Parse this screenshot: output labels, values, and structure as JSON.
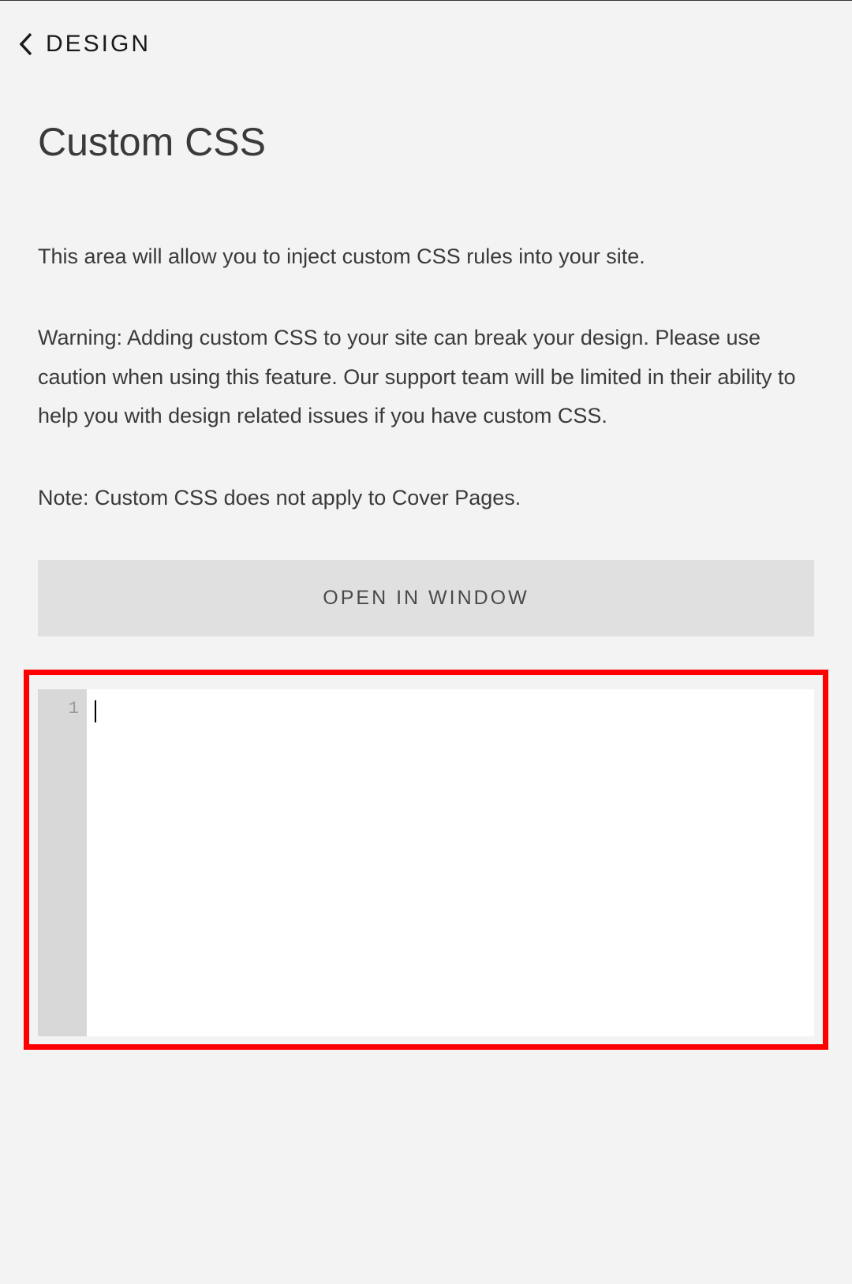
{
  "header": {
    "breadcrumb": "DESIGN"
  },
  "page": {
    "title": "Custom CSS",
    "description": "This area will allow you to inject custom CSS rules into your site.",
    "warning": "Warning: Adding custom CSS to your site can break your design. Please use caution when using this feature. Our support team will be limited in their ability to help you with design related issues if you have custom CSS.",
    "note": "Note: Custom CSS does not apply to Cover Pages."
  },
  "buttons": {
    "open_in_window": "OPEN IN WINDOW"
  },
  "editor": {
    "line_numbers": [
      "1"
    ],
    "content": ""
  }
}
